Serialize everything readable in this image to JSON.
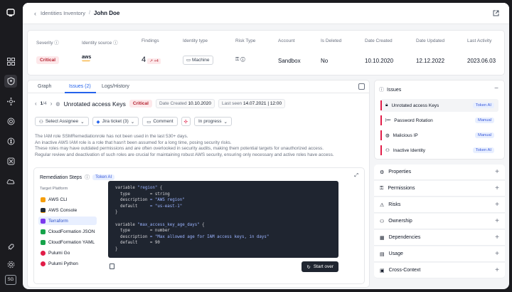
{
  "header": {
    "breadcrumb_parent": "Identities Inventory",
    "separator": "/",
    "current": "John Doe"
  },
  "summary": {
    "columns": [
      {
        "label": "Severity",
        "value": "Critical"
      },
      {
        "label": "Identity source",
        "value": "aws"
      },
      {
        "label": "Findings",
        "value": "4",
        "delta": "↗ +4"
      },
      {
        "label": "Identity type",
        "value": "Machine"
      },
      {
        "label": "Risk Type",
        "value": ""
      },
      {
        "label": "Account",
        "value": "Sandbox"
      },
      {
        "label": "Is Deleted",
        "value": "No"
      },
      {
        "label": "Date Created",
        "value": "10.10.2020"
      },
      {
        "label": "Date Updated",
        "value": "12.12.2022"
      },
      {
        "label": "Last Activity",
        "value": "2023.06.03"
      }
    ]
  },
  "tabs": [
    {
      "label": "Graph"
    },
    {
      "label": "Issues (2)"
    },
    {
      "label": "Logs/History"
    }
  ],
  "issue": {
    "pager_cur": "1",
    "pager_total": "/4",
    "title": "Unrotated access Keys",
    "severity": "Critical",
    "created_label": "Date Created",
    "created": "10.10.2020",
    "seen_label": "Last seen",
    "seen": "14.07.2021 | 12:00",
    "actions": {
      "assignee": "Select Assignee",
      "jira": "Jira ticket (3)",
      "comment": "Comment",
      "status": "In progress"
    },
    "description": [
      "The IAM role SSMRemediationrole has not been used in the last 530+ days.",
      "An inactive AWS IAM role is a role that hasn't been assumed for a long time, posing security risks.",
      "These roles may have outdated permissions and are often overlooked in security audits, making them potential targets for unauthorized access.",
      "Regular review and deactivation of such roles are crucial for maintaining robust AWS security, ensuring only necessary and active roles have access."
    ]
  },
  "remediation": {
    "title": "Remediation Steps",
    "badge": "Token AI",
    "platform_label": "Target Platform",
    "platforms": [
      {
        "label": "AWS CLI",
        "color": "#f59e0b"
      },
      {
        "label": "AWS Console",
        "color": "#1f2937"
      },
      {
        "label": "Terraform",
        "color": "#7c3aed"
      },
      {
        "label": "CloudFormation JSON",
        "color": "#16a34a"
      },
      {
        "label": "CloudFormation YAML",
        "color": "#16a34a"
      },
      {
        "label": "Pulumi Go",
        "color": "#e11d48"
      },
      {
        "label": "Pulumi Python",
        "color": "#e11d48"
      }
    ],
    "code_lines": [
      {
        "k": "variable ",
        "s": "\"region\"",
        "r": " {"
      },
      {
        "k": "  type",
        "s": "",
        "r": "        = string"
      },
      {
        "k": "  description",
        "s": " = \"AWS region\"",
        "r": ""
      },
      {
        "k": "  default",
        "s": "     = \"us-east-1\"",
        "r": ""
      },
      {
        "k": "}",
        "s": "",
        "r": ""
      },
      {
        "k": "",
        "s": "",
        "r": ""
      },
      {
        "k": "variable ",
        "s": "\"max_access_key_age_days\"",
        "r": " {"
      },
      {
        "k": "  type",
        "s": "",
        "r": "        = number"
      },
      {
        "k": "  description",
        "s": " = \"Max allowed age for IAM access keys, in days\"",
        "r": ""
      },
      {
        "k": "  default",
        "s": "",
        "r": "     = 90"
      },
      {
        "k": "}",
        "s": "",
        "r": ""
      }
    ],
    "start_over": "Start over"
  },
  "right": {
    "issues_title": "Issues",
    "issues": [
      {
        "label": "Unrotated access Keys",
        "tag": "Token AI"
      },
      {
        "label": "Password Rotation",
        "tag": "Manual"
      },
      {
        "label": "Malicious IP",
        "tag": "Manual"
      },
      {
        "label": "Inactive Identity",
        "tag": "Token AI"
      }
    ],
    "sections": [
      "Properties",
      "Permissions",
      "Risks",
      "Ownership",
      "Dependencies",
      "Usage",
      "Cross-Context"
    ]
  },
  "user": {
    "initials": "SG"
  }
}
